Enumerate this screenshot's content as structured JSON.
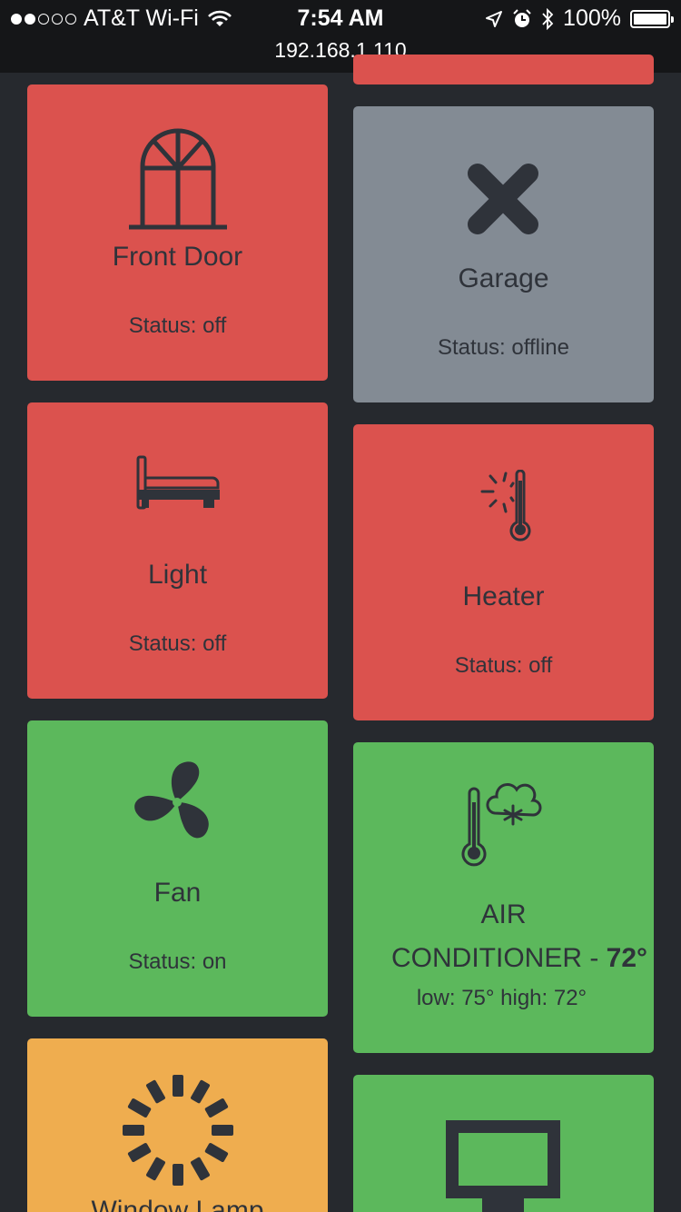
{
  "status_bar": {
    "carrier": "AT&T Wi-Fi",
    "time": "7:54 AM",
    "battery": "100%",
    "url": "192.168.1.110"
  },
  "tiles": {
    "front_door": {
      "name": "Front Door",
      "status": "Status: off",
      "color": "#db524e",
      "icon": "window-icon"
    },
    "garage": {
      "name": "Garage",
      "status": "Status: offline",
      "color": "#838b94",
      "icon": "close-x-icon"
    },
    "light": {
      "name": "Light",
      "status": "Status: off",
      "color": "#db524e",
      "icon": "bed-icon"
    },
    "heater": {
      "name": "Heater",
      "status": "Status: off",
      "color": "#db524e",
      "icon": "thermometer-hot-icon"
    },
    "fan": {
      "name": "Fan",
      "status": "Status: on",
      "color": "#5cb85c",
      "icon": "fan-icon"
    },
    "air_conditioner": {
      "name_line1": "AIR",
      "name_line2": "CONDITIONER - ",
      "temp": "72°",
      "range": "low: 75° high: 72°",
      "color": "#5cb85c",
      "icon": "thermometer-snow-icon"
    },
    "window_lamp": {
      "name": "Window Lamp",
      "color": "#efad4f",
      "icon": "spinner-icon"
    },
    "tv": {
      "color": "#5cb85c",
      "icon": "monitor-icon"
    }
  }
}
